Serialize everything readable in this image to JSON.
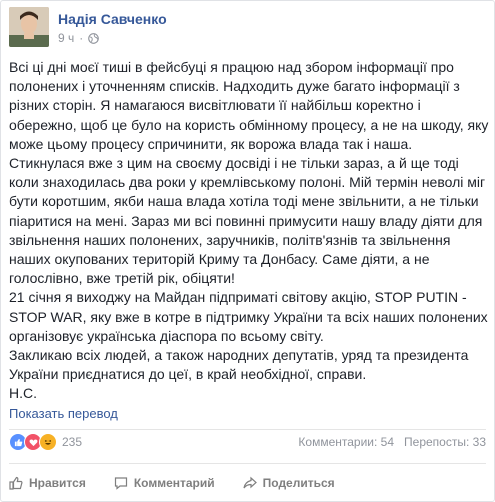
{
  "post": {
    "author": "Надія Савченко",
    "time": "9 ч",
    "icons": {
      "privacy": "globe-icon"
    },
    "text": "Всі ці дні моєї тиші в фейсбуці я працюю над збором інформації про полонених і уточненням списків. Надходить дуже багато інформації з різних сторін. Я намагаюся висвітлювати її найбільш коректно і обережно, щоб це було на користь обмінному процесу, а не на шкоду, яку може цьому процесу спричинити, як ворожа влада так і наша.\nСтикнулася вже з цим на своєму досвіді і не тільки зараз, а й ще тоді коли знаходилась два роки у кремлівському полоні. Мій термін неволі міг бути коротшим, якби наша влада хотіла тоді мене звільнити, а не тільки піаритися на мені. Зараз ми всі повинні примусити нашу владу діяти для звільнення наших полонених, заручників, політв'язнів та звільнення наших окупованих територій Криму та Донбасу. Саме діяти, а не голослівно, вже третій рік, обіцяти!\n21 січня я виходжу на Майдан підприматі світову акцію, STOP PUTIN - STOP WAR, яку вже в котре в підтримку України та всіх наших полонених організовує українська діаспора по всьому світу.\nЗакликаю всіх людей, а також народних депутатів, уряд та президента України приєднатися до цеї, в край необхідної, справи.\nН.С.",
    "translate_link": "Показать перевод"
  },
  "stats": {
    "reactions_count": "235",
    "comments": "Комментарии: 54",
    "shares": "Перепосты: 33",
    "reaction_icons": [
      "like-reaction-icon",
      "love-reaction-icon",
      "haha-reaction-icon"
    ]
  },
  "actions": {
    "like": "Нравится",
    "comment": "Комментарий",
    "share": "Поделиться"
  },
  "colors": {
    "link": "#365899",
    "muted": "#90949c",
    "text": "#1d2129"
  }
}
